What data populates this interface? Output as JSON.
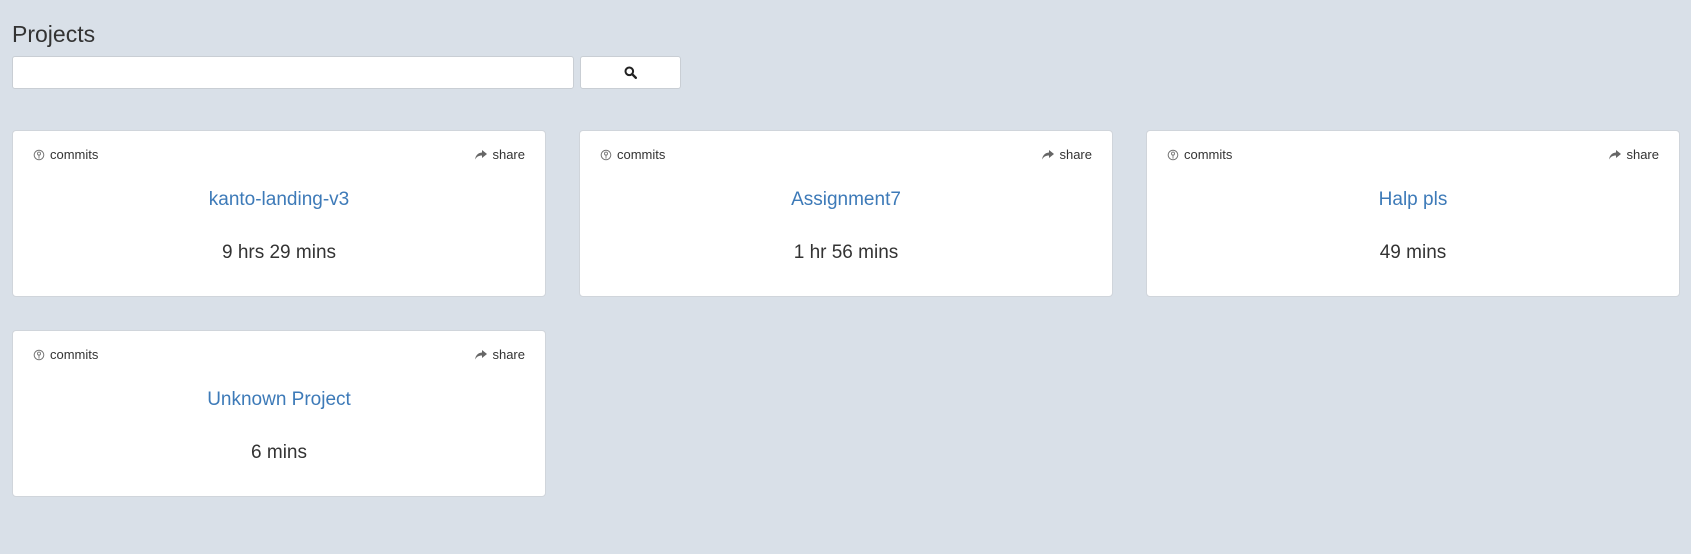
{
  "header": {
    "title": "Projects"
  },
  "search": {
    "value": "",
    "placeholder": "",
    "button_icon": "search-icon"
  },
  "projects": [
    {
      "name": "kanto-landing-v3",
      "time": "9 hrs 29 mins",
      "commits_label": "commits",
      "share_label": "share"
    },
    {
      "name": "Assignment7",
      "time": "1 hr 56 mins",
      "commits_label": "commits",
      "share_label": "share"
    },
    {
      "name": "Halp pls",
      "time": "49 mins",
      "commits_label": "commits",
      "share_label": "share"
    },
    {
      "name": "Unknown Project",
      "time": "6 mins",
      "commits_label": "commits",
      "share_label": "share"
    }
  ],
  "colors": {
    "background": "#d9e0e8",
    "link": "#3d7ab8",
    "text": "#333333"
  }
}
